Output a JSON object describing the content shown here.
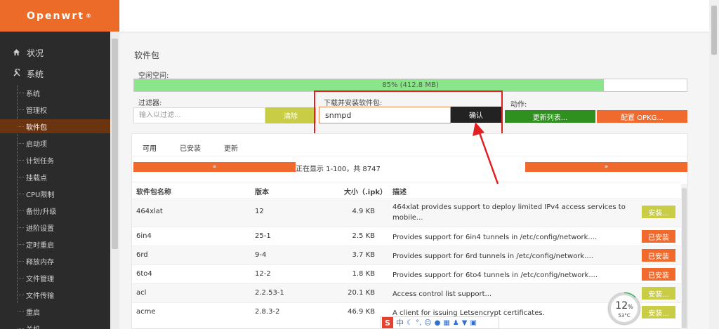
{
  "brand": {
    "name": "Openwrt",
    "mark": "®"
  },
  "sidebar": {
    "top": [
      {
        "label": "状况",
        "icon": "home-icon"
      },
      {
        "label": "系统",
        "icon": "wrench-icon"
      }
    ],
    "items": [
      {
        "label": "系统"
      },
      {
        "label": "管理权"
      },
      {
        "label": "软件包",
        "active": true
      },
      {
        "label": "启动项"
      },
      {
        "label": "计划任务"
      },
      {
        "label": "挂载点"
      },
      {
        "label": "CPU限制"
      },
      {
        "label": "备份/升级"
      },
      {
        "label": "进阶设置"
      },
      {
        "label": "定时重启"
      },
      {
        "label": "释放内存"
      },
      {
        "label": "文件管理"
      },
      {
        "label": "文件传输"
      },
      {
        "label": "重启"
      },
      {
        "label": "关机"
      }
    ]
  },
  "page": {
    "title": "软件包"
  },
  "storage": {
    "label": "空闲空间:",
    "text": "85% (412.8 MB)",
    "percent": 85
  },
  "filter": {
    "label": "过滤器:",
    "placeholder": "输入以过滤...",
    "clear_label": "清除"
  },
  "download": {
    "label": "下载并安装软件包:",
    "value": "snmpd",
    "confirm_label": "确认"
  },
  "actions": {
    "label": "动作:",
    "update_label": "更新列表...",
    "config_label": "配置 OPKG..."
  },
  "tabs": [
    {
      "label": "可用"
    },
    {
      "label": "已安装"
    },
    {
      "label": "更新"
    }
  ],
  "pager": {
    "prev": "«",
    "next": "»",
    "status": "正在显示 1-100，共 8747"
  },
  "table": {
    "headers": {
      "name": "软件包名称",
      "version": "版本",
      "size": "大小（.ipk）",
      "desc": "描述"
    },
    "rows": [
      {
        "name": "464xlat",
        "version": "12",
        "size": "4.9 KB",
        "desc": "464xlat provides support to deploy limited IPv4 access services to mobile...",
        "action": "安装...",
        "status": "install"
      },
      {
        "name": "6in4",
        "version": "25-1",
        "size": "2.5 KB",
        "desc": "Provides support for 6in4 tunnels in /etc/config/network....",
        "action": "已安装",
        "status": "installed"
      },
      {
        "name": "6rd",
        "version": "9-4",
        "size": "3.7 KB",
        "desc": "Provides support for 6rd tunnels in /etc/config/network....",
        "action": "已安装",
        "status": "installed"
      },
      {
        "name": "6to4",
        "version": "12-2",
        "size": "1.8 KB",
        "desc": "Provides support for 6to4 tunnels in /etc/config/network....",
        "action": "已安装",
        "status": "installed"
      },
      {
        "name": "acl",
        "version": "2.2.53-1",
        "size": "20.1 KB",
        "desc": "Access control list support...",
        "action": "安装...",
        "status": "install"
      },
      {
        "name": "acme",
        "version": "2.8.3-2",
        "size": "46.9 KB",
        "desc": "A client for issuing Letsencrypt certificates.",
        "action": "安装...",
        "status": "install"
      }
    ]
  },
  "widget": {
    "percent": "12",
    "percent_sign": "%",
    "temp": "53°C"
  },
  "ime": {
    "logo": "S",
    "mode": "中"
  },
  "colors": {
    "accent": "#ec6b28",
    "sidebar": "#2b2b2b",
    "install": "#c9cc45",
    "installed": "#ef6a2c",
    "update": "#2f8f1f",
    "progress": "#8be58b"
  }
}
